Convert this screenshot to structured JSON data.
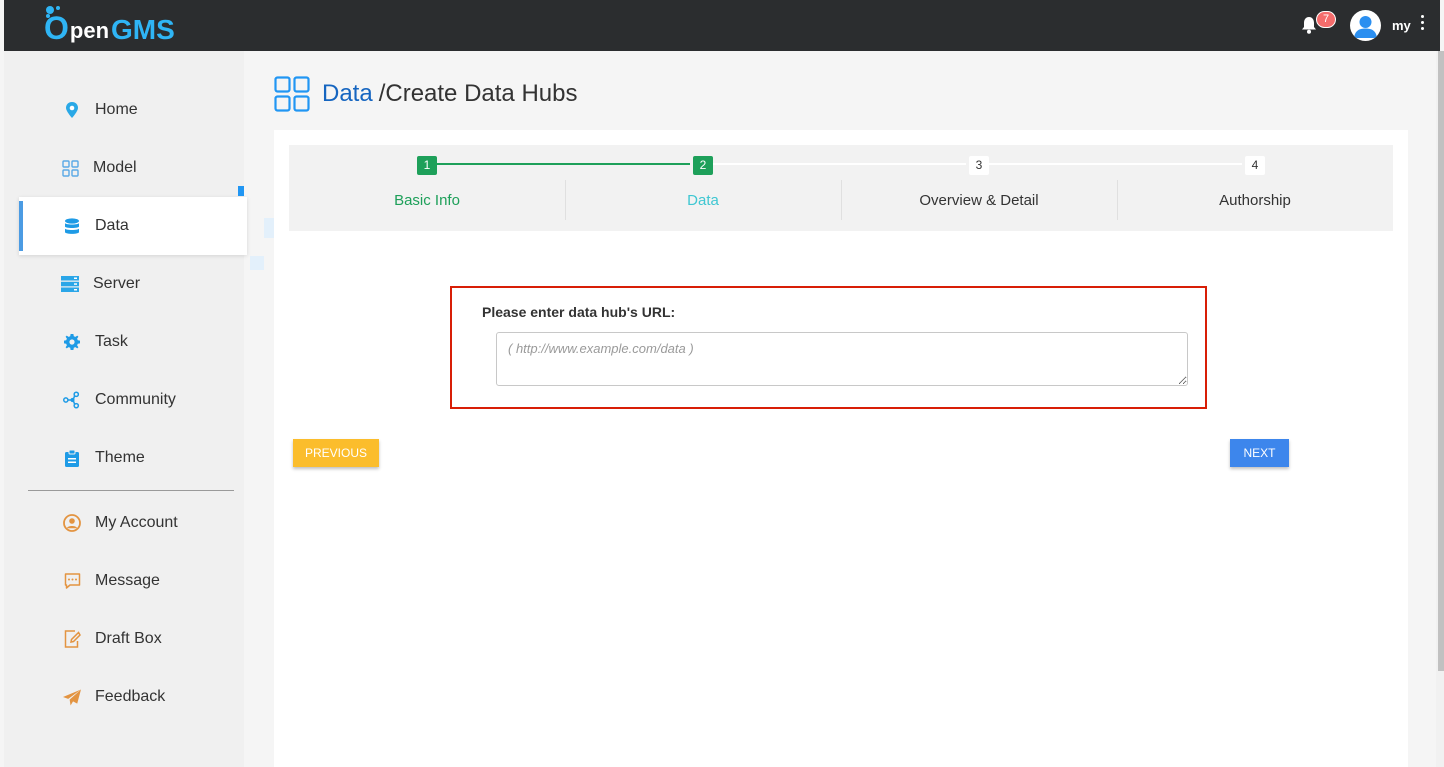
{
  "header": {
    "logo_o": "O",
    "logo_pen": "pen",
    "logo_gms": "GMS",
    "notification_count": "7",
    "username": "my"
  },
  "sidebar": {
    "items": [
      {
        "label": "Home",
        "icon": "location-pin-icon"
      },
      {
        "label": "Model",
        "icon": "grid-icon"
      },
      {
        "label": "Data",
        "icon": "database-icon"
      },
      {
        "label": "Server",
        "icon": "server-icon"
      },
      {
        "label": "Task",
        "icon": "gear-icon"
      },
      {
        "label": "Community",
        "icon": "share-nodes-icon"
      },
      {
        "label": "Theme",
        "icon": "clipboard-icon"
      },
      {
        "label": "My Account",
        "icon": "user-circle-icon"
      },
      {
        "label": "Message",
        "icon": "message-icon"
      },
      {
        "label": "Draft Box",
        "icon": "edit-document-icon"
      },
      {
        "label": "Feedback",
        "icon": "paper-plane-icon"
      }
    ],
    "active": "Data"
  },
  "page": {
    "breadcrumb_root": "Data",
    "breadcrumb_rest": "/Create Data Hubs"
  },
  "steps": [
    {
      "number": "1",
      "label": "Basic Info",
      "state": "done"
    },
    {
      "number": "2",
      "label": "Data",
      "state": "current"
    },
    {
      "number": "3",
      "label": "Overview & Detail",
      "state": "todo"
    },
    {
      "number": "4",
      "label": "Authorship",
      "state": "todo"
    }
  ],
  "form": {
    "url_label": "Please enter data hub's URL:",
    "url_placeholder": "( http://www.example.com/data )",
    "url_value": ""
  },
  "buttons": {
    "previous": "PREVIOUS",
    "next": "NEXT"
  },
  "colors": {
    "topbar": "#2b2d2f",
    "brand": "#2fb5f5",
    "step_done": "#1ea05a",
    "step_current_text": "#3fc7d2",
    "link_blue": "#1565c0",
    "previous_button": "#fbbd2c",
    "next_button": "#3d86ec",
    "highlight_border": "#d81e06"
  }
}
